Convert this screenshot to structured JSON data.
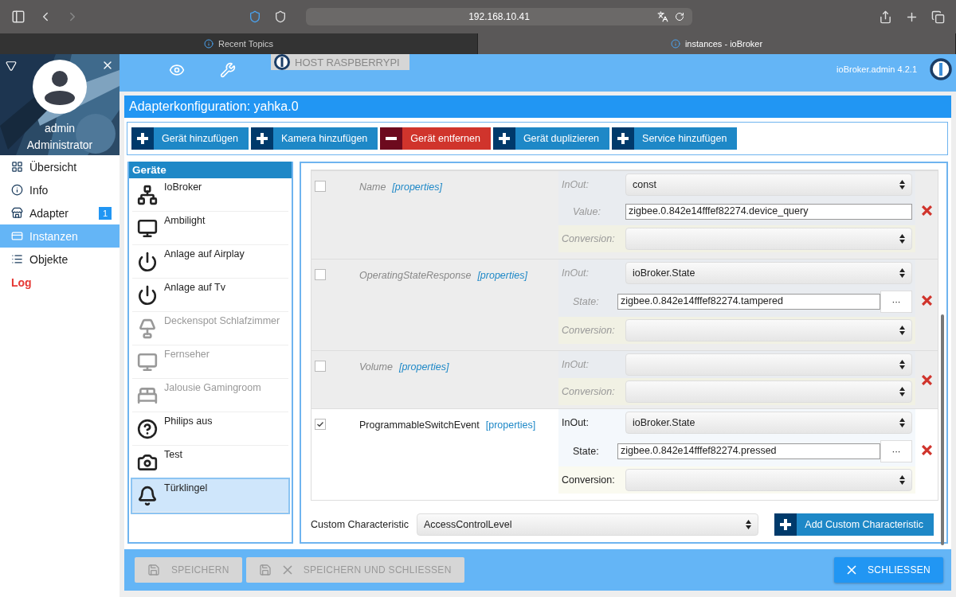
{
  "browser": {
    "url": "192.168.10.41",
    "tabs": [
      {
        "title": "Recent Topics",
        "selected": false
      },
      {
        "title": "instances - ioBroker",
        "selected": true
      }
    ]
  },
  "sidebar": {
    "user": {
      "name": "admin",
      "role": "Administrator"
    },
    "items": [
      {
        "label": "Übersicht",
        "kind": "grid",
        "selected": false,
        "color": "#222222"
      },
      {
        "label": "Info",
        "kind": "info",
        "selected": false,
        "color": "#222222"
      },
      {
        "label": "Adapter",
        "kind": "store",
        "selected": false,
        "color": "#222222",
        "badge": "1"
      },
      {
        "label": "Instanzen",
        "kind": "card",
        "selected": true,
        "color": "#ffffff"
      },
      {
        "label": "Objekte",
        "kind": "list",
        "selected": false,
        "color": "#222222"
      },
      {
        "label": "Log",
        "kind": "none",
        "selected": false,
        "color": "#e53935"
      }
    ]
  },
  "header": {
    "host": "HOST RASPBERRYPI",
    "version": "ioBroker.admin 4.2.1"
  },
  "dialog": {
    "title": "Adapterkonfiguration: yahka.0",
    "toolbar": [
      {
        "label": "Gerät hinzufügen",
        "kind": "add"
      },
      {
        "label": "Kamera hinzufügen",
        "kind": "add"
      },
      {
        "label": "Gerät entfernen",
        "kind": "remove"
      },
      {
        "label": "Gerät duplizieren",
        "kind": "add"
      },
      {
        "label": "Service hinzufügen",
        "kind": "add"
      }
    ],
    "devices": {
      "title": "Geräte",
      "items": [
        {
          "label": "IoBroker",
          "kind": "network",
          "disabled": false,
          "selected": false
        },
        {
          "label": "Ambilight",
          "kind": "screen",
          "disabled": false,
          "selected": false
        },
        {
          "label": "Anlage auf Airplay",
          "kind": "power",
          "disabled": false,
          "selected": false
        },
        {
          "label": "Anlage auf Tv",
          "kind": "power",
          "disabled": false,
          "selected": false
        },
        {
          "label": "Deckenspot Schlafzimmer",
          "kind": "lamp",
          "disabled": true,
          "selected": false
        },
        {
          "label": "Fernseher",
          "kind": "screen",
          "disabled": true,
          "selected": false
        },
        {
          "label": "Jalousie Gamingroom",
          "kind": "bed",
          "disabled": true,
          "selected": false
        },
        {
          "label": "Philips aus",
          "kind": "unknown",
          "disabled": false,
          "selected": false
        },
        {
          "label": "Test",
          "kind": "camera",
          "disabled": false,
          "selected": false
        },
        {
          "label": "Türklingel",
          "kind": "bell",
          "disabled": false,
          "selected": true
        }
      ]
    },
    "characteristics": [
      {
        "name": "Name",
        "link": "[properties]",
        "checked": false,
        "fields": [
          {
            "label": "InOut:",
            "kind": "select",
            "value": "const"
          },
          {
            "label": "Value:",
            "kind": "text",
            "value": "zigbee.0.842e14fffef82274.device_query"
          },
          {
            "label": "Conversion:",
            "kind": "select"
          }
        ]
      },
      {
        "name": "OperatingStateResponse",
        "link": "[properties]",
        "checked": false,
        "fields": [
          {
            "label": "InOut:",
            "kind": "select",
            "value": "ioBroker.State"
          },
          {
            "label": "State:",
            "kind": "state",
            "value": "zigbee.0.842e14fffef82274.tampered",
            "button": "···"
          },
          {
            "label": "Conversion:",
            "kind": "select"
          }
        ]
      },
      {
        "name": "Volume",
        "link": "[properties]",
        "checked": false,
        "fields": [
          {
            "label": "InOut:",
            "kind": "select"
          },
          {
            "label": "Conversion:",
            "kind": "select"
          }
        ]
      },
      {
        "name": "ProgrammableSwitchEvent",
        "link": "[properties]",
        "checked": true,
        "fields": [
          {
            "label": "InOut:",
            "kind": "select",
            "value": "ioBroker.State"
          },
          {
            "label": "State:",
            "kind": "state",
            "value": "zigbee.0.842e14fffef82274.pressed",
            "button": "···"
          },
          {
            "label": "Conversion:",
            "kind": "select"
          }
        ]
      }
    ],
    "custom": {
      "label": "Custom Characteristic",
      "value": "AccessControlLevel",
      "button": "Add Custom Characteristic"
    },
    "footer": [
      {
        "label": "SPEICHERN",
        "kind": "save",
        "disabled": true
      },
      {
        "label": "SPEICHERN UND SCHLIESSEN",
        "kind": "save-close",
        "disabled": true
      },
      {
        "label": "SCHLIESSEN",
        "kind": "close",
        "disabled": false
      }
    ]
  }
}
